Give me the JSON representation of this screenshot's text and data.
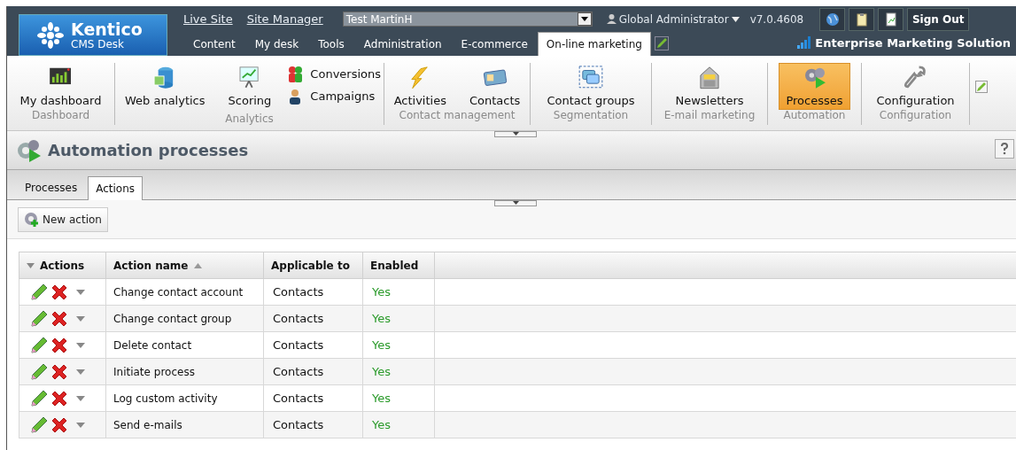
{
  "header": {
    "logo": {
      "name": "Kentico",
      "subtitle": "CMS Desk"
    },
    "links": [
      "Live Site",
      "Site Manager"
    ],
    "site_select": {
      "value": "Test MartinH"
    },
    "user": "Global Administrator",
    "version": "v7.0.4608",
    "sign_out": "Sign Out",
    "edition": "Enterprise Marketing Solution"
  },
  "main_tabs": [
    {
      "label": "Content",
      "selected": false
    },
    {
      "label": "My desk",
      "selected": false
    },
    {
      "label": "Tools",
      "selected": false
    },
    {
      "label": "Administration",
      "selected": false
    },
    {
      "label": "E-commerce",
      "selected": false
    },
    {
      "label": "On-line marketing",
      "selected": true
    }
  ],
  "ribbon": [
    {
      "label": "Dashboard",
      "items": [
        {
          "label": "My dashboard",
          "kind": "large",
          "selected": false
        }
      ]
    },
    {
      "label": "Analytics",
      "items": [
        {
          "label": "Web analytics",
          "kind": "large",
          "selected": false
        },
        {
          "label": "Scoring",
          "kind": "large",
          "selected": false
        },
        {
          "label": "Conversions",
          "kind": "small",
          "selected": false
        },
        {
          "label": "Campaigns",
          "kind": "small",
          "selected": false
        }
      ]
    },
    {
      "label": "Contact management",
      "items": [
        {
          "label": "Activities",
          "kind": "large",
          "selected": false
        },
        {
          "label": "Contacts",
          "kind": "large",
          "selected": false
        }
      ]
    },
    {
      "label": "Segmentation",
      "items": [
        {
          "label": "Contact groups",
          "kind": "large",
          "selected": false
        }
      ]
    },
    {
      "label": "E-mail marketing",
      "items": [
        {
          "label": "Newsletters",
          "kind": "large",
          "selected": false
        }
      ]
    },
    {
      "label": "Automation",
      "items": [
        {
          "label": "Processes",
          "kind": "large",
          "selected": true
        }
      ]
    },
    {
      "label": "Configuration",
      "items": [
        {
          "label": "Configuration",
          "kind": "large",
          "selected": false
        }
      ]
    }
  ],
  "page_title": "Automation processes",
  "sub_tabs": [
    {
      "label": "Processes",
      "selected": false
    },
    {
      "label": "Actions",
      "selected": true
    }
  ],
  "new_action_button": "New action",
  "table": {
    "columns": [
      {
        "label": "Actions",
        "sorted": false
      },
      {
        "label": "Action name",
        "sorted": true
      },
      {
        "label": "Applicable to",
        "sorted": false
      },
      {
        "label": "Enabled",
        "sorted": false
      }
    ],
    "rows": [
      {
        "action_name": "Change contact account",
        "applicable_to": "Contacts",
        "enabled": "Yes"
      },
      {
        "action_name": "Change contact group",
        "applicable_to": "Contacts",
        "enabled": "Yes"
      },
      {
        "action_name": "Delete contact",
        "applicable_to": "Contacts",
        "enabled": "Yes"
      },
      {
        "action_name": "Initiate process",
        "applicable_to": "Contacts",
        "enabled": "Yes"
      },
      {
        "action_name": "Log custom activity",
        "applicable_to": "Contacts",
        "enabled": "Yes"
      },
      {
        "action_name": "Send e-mails",
        "applicable_to": "Contacts",
        "enabled": "Yes"
      }
    ]
  }
}
